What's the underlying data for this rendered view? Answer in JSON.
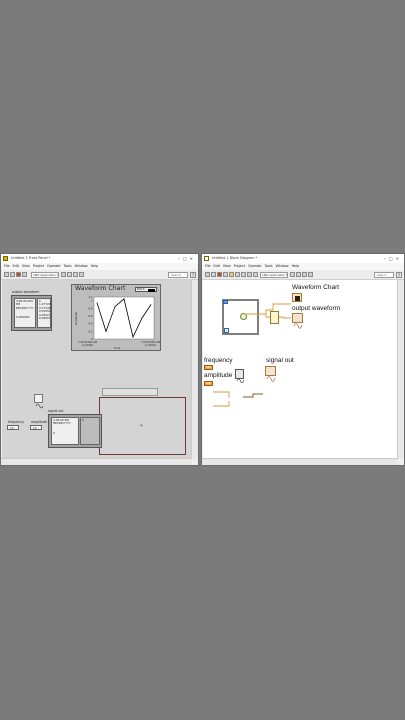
{
  "front_panel": {
    "title": "Untitled 1 Front Panel *",
    "menu": [
      "File",
      "Edit",
      "View",
      "Project",
      "Operate",
      "Tools",
      "Window",
      "Help"
    ],
    "font_selector": "18pt Application Font",
    "search_placeholder": "Search",
    "output_waveform_cluster": {
      "label": "output waveform",
      "t0": "4:00:00.000 PM",
      "t0_date": "MM/DD/YYYY",
      "dt": "0.000000",
      "y_index": "0",
      "y_values": [
        "1.07720",
        "0.77249",
        "0.05050",
        "0.05027",
        "0.06607"
      ]
    },
    "waveform_chart": {
      "title": "Waveform Chart",
      "legend": "Plot 0",
      "ylabel": "Amplitude",
      "xlabel": "Time",
      "x_start": "7:00:00.000 AM",
      "x_start_date": "1/1/1904",
      "x_end": "7:00:05.000 AM",
      "x_end_date": "1/1/1904",
      "y_ticks": [
        "1.1",
        "1",
        "0.8",
        "0.6",
        "0.4",
        "0.2",
        "0"
      ]
    },
    "signal_out_cluster": {
      "label": "signal out",
      "t0": "4:00:00 PM",
      "t0_date": "MM/DD/YYYY",
      "dt": "0",
      "y_index": "0"
    },
    "frequency": {
      "label": "frequency",
      "value": "10"
    },
    "amplitude": {
      "label": "amplitude",
      "value": "10"
    }
  },
  "block_diagram": {
    "title": "Untitled 1 Block Diagram *",
    "menu": [
      "File",
      "Edit",
      "View",
      "Project",
      "Operate",
      "Tools",
      "Window",
      "Help"
    ],
    "font_selector": "18pt Application Font",
    "search_placeholder": "Search",
    "labels": {
      "waveform_chart": "Waveform Chart",
      "output_waveform": "output waveform",
      "frequency": "frequency",
      "amplitude": "amplitude",
      "signal_out": "signal out"
    },
    "loop_counter": "i",
    "frequency_terminal_type": "DBL",
    "amplitude_terminal_type": "DBL"
  },
  "chart_data": {
    "type": "line",
    "title": "Waveform Chart",
    "xlabel": "Time",
    "ylabel": "Amplitude",
    "ylim": [
      0,
      1.1
    ],
    "series": [
      {
        "name": "Plot 0",
        "values": [
          0.95,
          0.2,
          0.85,
          1.05,
          0.05,
          0.55,
          0.9
        ]
      }
    ],
    "legend": "top-right",
    "grid": false
  }
}
